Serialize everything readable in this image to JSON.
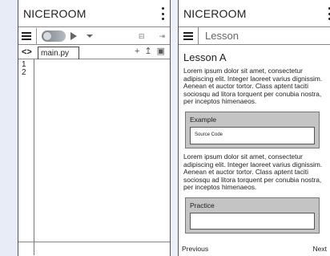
{
  "left": {
    "app_title": "NICEROOM",
    "file_tab": "main.py",
    "code_toggle": "<>",
    "line_numbers": [
      "1",
      "2"
    ],
    "action_icons": [
      "+",
      "↥",
      "▣"
    ],
    "toolbar_icons": [
      "⊟",
      "⇥"
    ]
  },
  "right": {
    "app_title": "NICEROOM",
    "breadcrumb": "Lesson",
    "lesson_title": "Lesson A",
    "paragraph1": "Lorem ipsum dolor sit amet, consectetur adipiscing elit. Integer laoreet varius dignissim. Aenean et auctor tortor. Class aptent taciti sociosqu ad litora torquent per conubia nostra, per inceptos himenaeos.",
    "example_label": "Example",
    "example_code": "Source Code",
    "paragraph2": "Lorem ipsum dolor sit amet, consectetur adipiscing elit. Integer laoreet varius dignissim. Aenean et auctor tortor. Class aptent taciti sociosqu ad litora torquent per conubia nostra, per inceptos himenaeos.",
    "practice_label": "Practice",
    "prev_label": "Previous",
    "next_label": "Next"
  }
}
